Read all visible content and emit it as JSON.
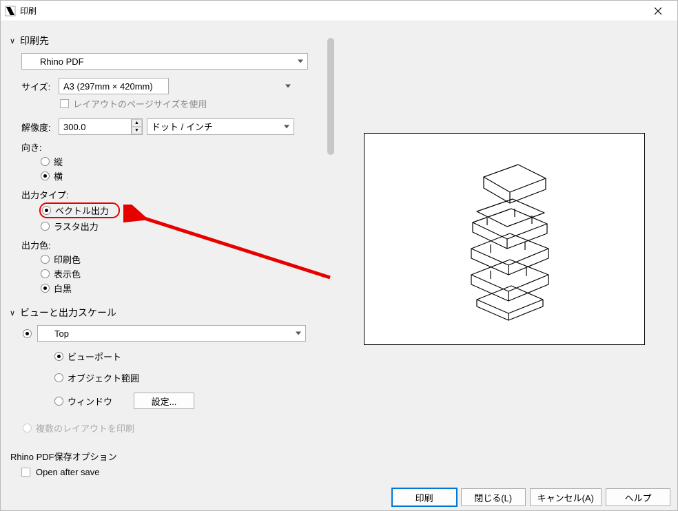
{
  "title": "印刷",
  "sections": {
    "destination": {
      "header": "印刷先",
      "printer": "Rhino PDF",
      "size_label": "サイズ:",
      "size_value": "A3 (297mm × 420mm)",
      "use_layout_page_size": "レイアウトのページサイズを使用",
      "res_label": "解像度:",
      "res_value": "300.0",
      "res_unit": "ドット / インチ",
      "orient_label": "向き:",
      "orient_portrait": "縦",
      "orient_landscape": "横",
      "output_type_label": "出力タイプ:",
      "output_vector": "ベクトル出力",
      "output_raster": "ラスタ出力",
      "output_color_label": "出力色:",
      "output_print": "印刷色",
      "output_display": "表示色",
      "output_bw": "白黒"
    },
    "view": {
      "header": "ビューと出力スケール",
      "view_name": "Top",
      "viewport": "ビューポート",
      "extents": "オブジェクト範囲",
      "window": "ウィンドウ",
      "set_button": "設定...",
      "multi_layout": "複数のレイアウトを印刷"
    },
    "save": {
      "header": "Rhino PDF保存オプション",
      "open_after": "Open after save"
    }
  },
  "footer": {
    "print": "印刷",
    "close": "閉じる(L)",
    "cancel": "キャンセル(A)",
    "help": "ヘルプ"
  }
}
